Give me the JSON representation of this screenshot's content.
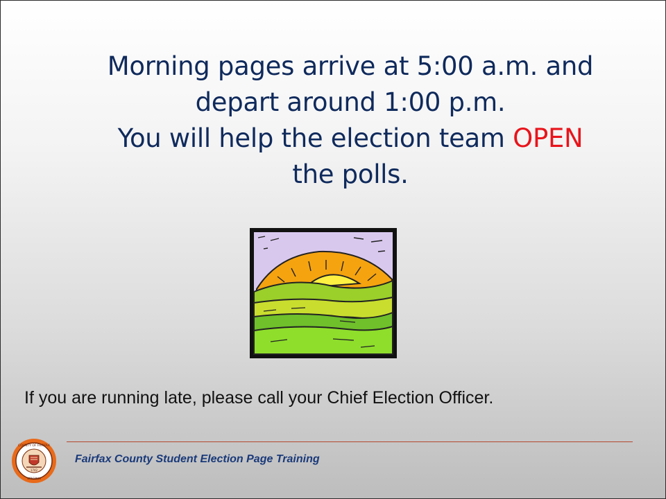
{
  "slide": {
    "headline": {
      "line1": "Morning pages arrive at 5:00 a.m. and",
      "line2": "depart around 1:00 p.m.",
      "line3_before": "You will help the election team ",
      "line3_accent": "OPEN",
      "line4": "the polls."
    },
    "note": "If you are running late, please call your Chief Election Officer.",
    "footer": "Fairfax County Student Election Page Training",
    "seal": {
      "top_text": "COUNTY OF FAIRFAX",
      "bottom_text": "VIRGINIA",
      "year": "1742"
    }
  },
  "colors": {
    "headline": "#0f2a5c",
    "accent": "#e8141b",
    "footer": "#1a3a7a",
    "rule": "#b5482e"
  },
  "icons": {
    "illustration": "sunrise-over-hills-clipart",
    "seal": "county-seal-icon"
  }
}
